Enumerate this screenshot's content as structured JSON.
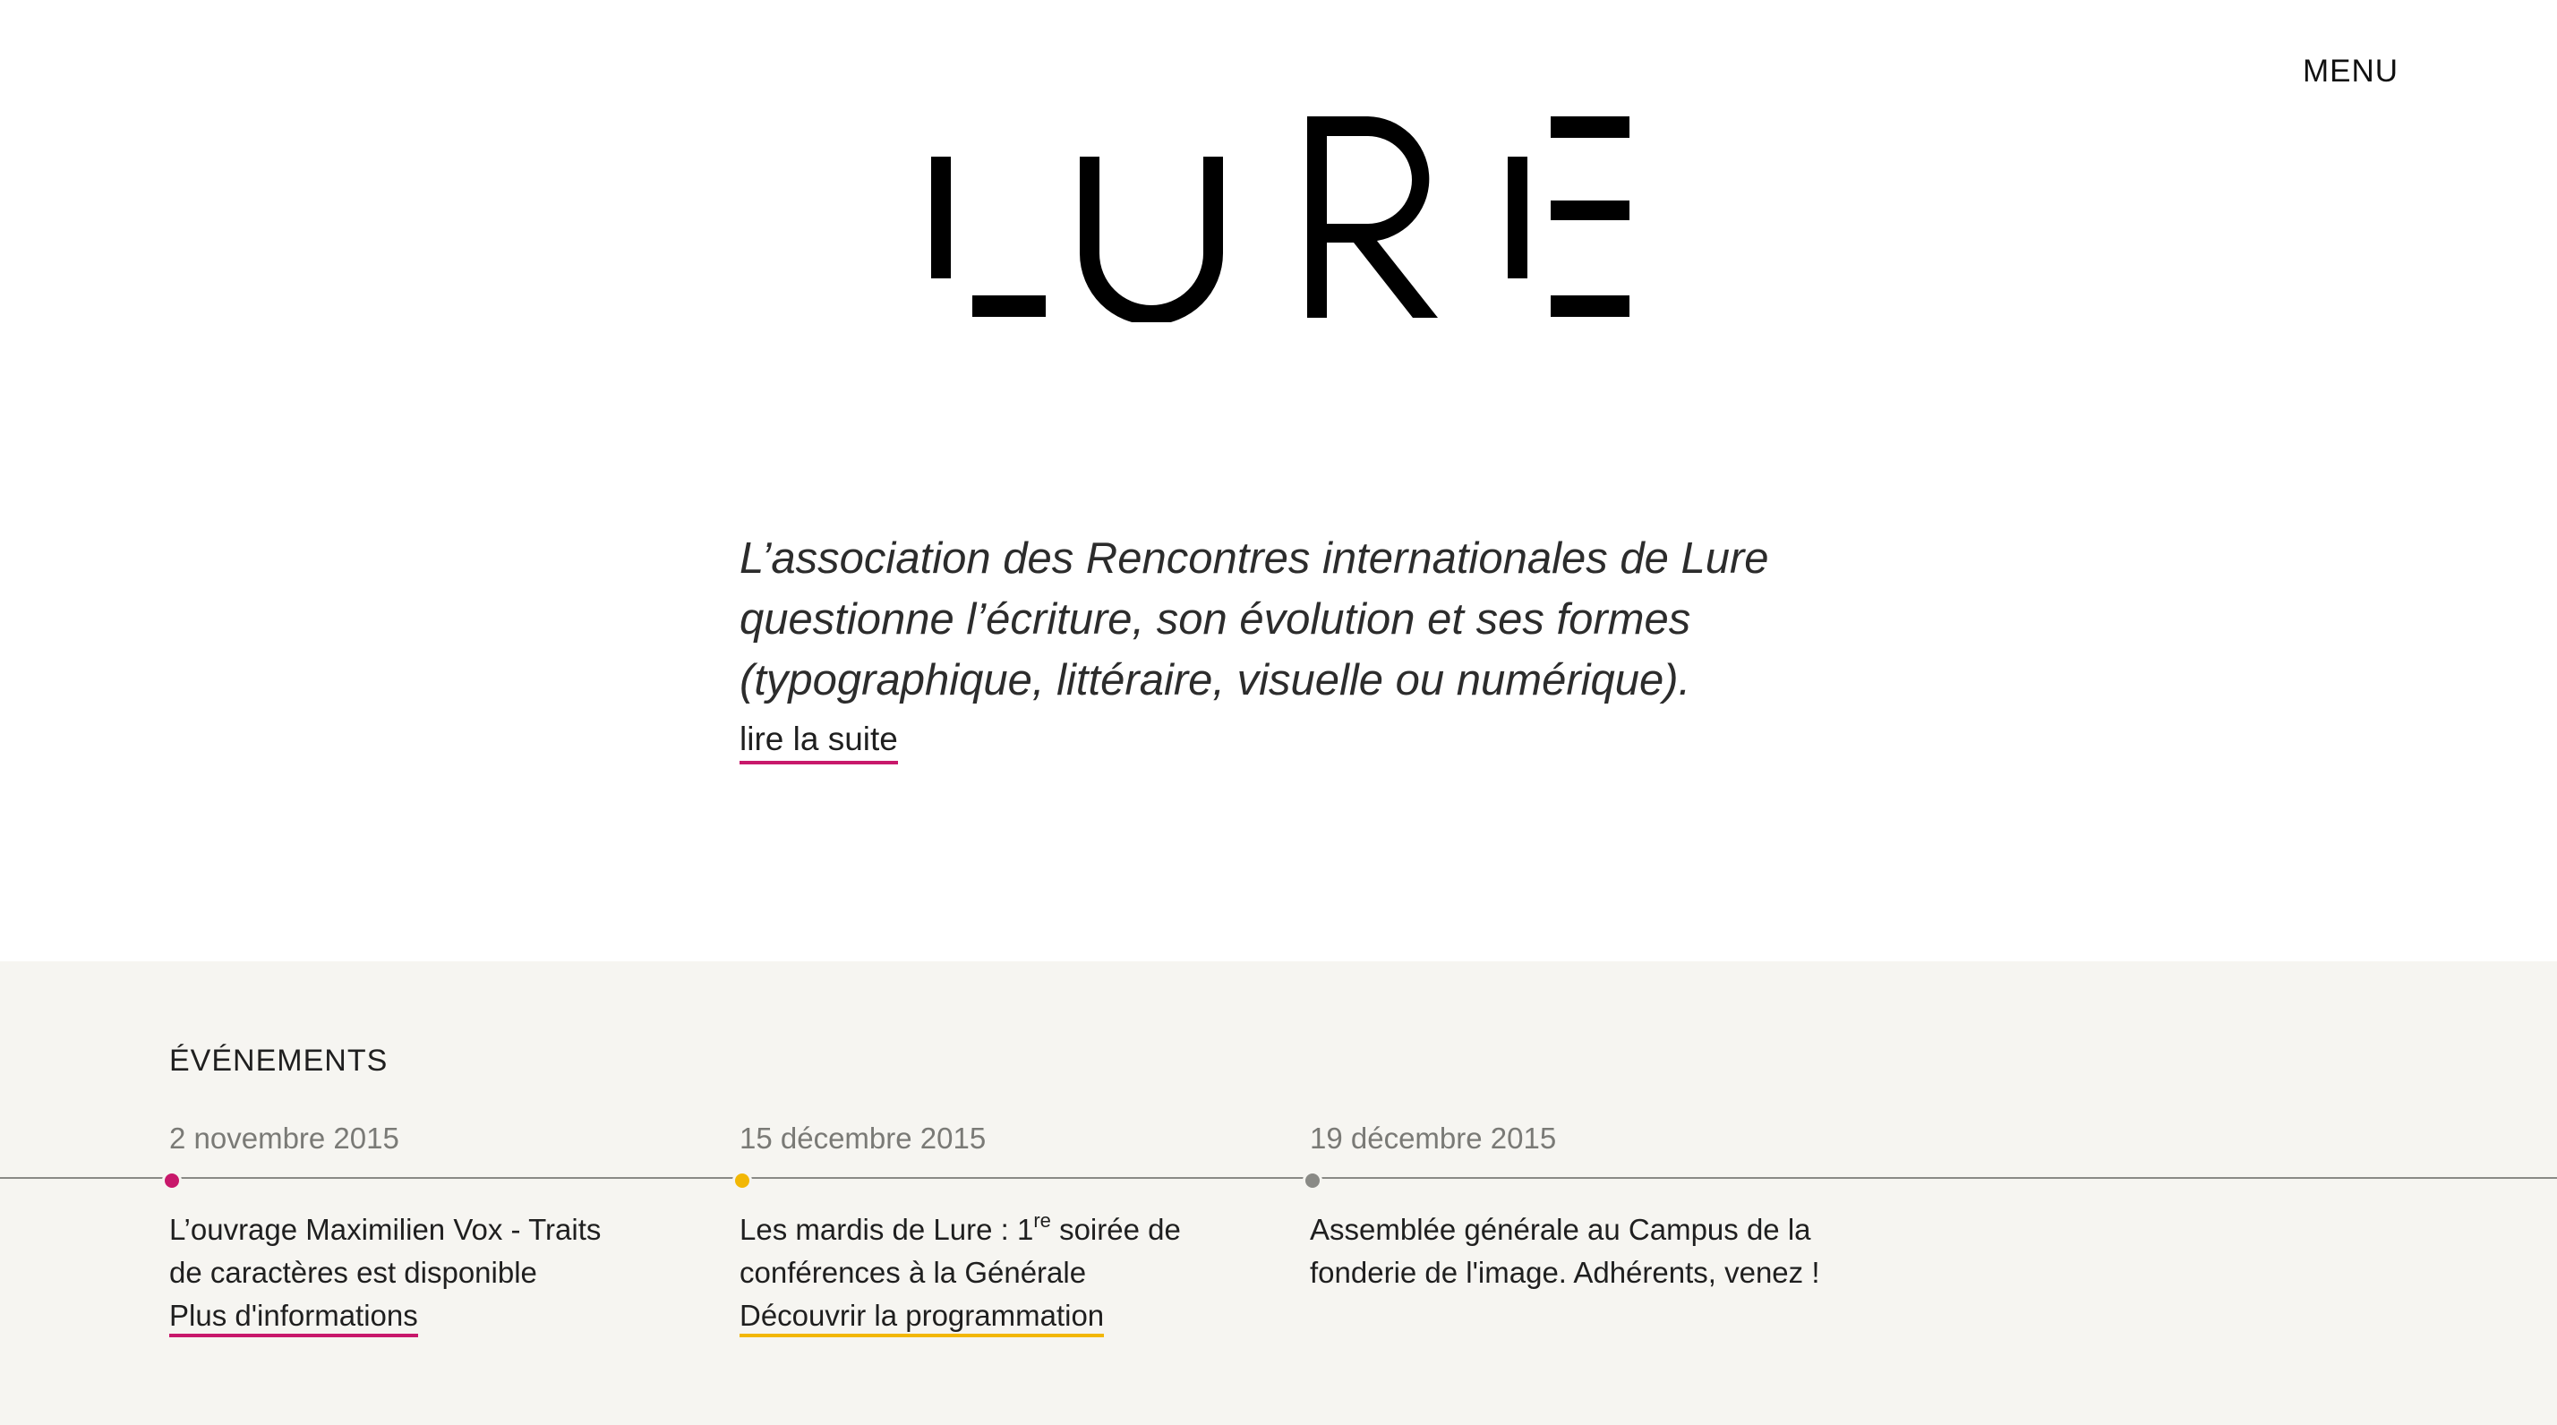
{
  "header": {
    "menu_label": "MENU",
    "logo_text": "LURE"
  },
  "intro": {
    "lines": [
      "L’association des Rencontres internationales de Lure",
      "questionne l’écriture, son évolution et ses formes",
      "(typographique, littéraire, visuelle ou numérique)."
    ],
    "read_more_label": "lire la suite",
    "read_more_color": "#c8186b"
  },
  "events": {
    "heading": "ÉVÉNEMENTS",
    "background": "#f6f5f1",
    "items": [
      {
        "date": "2 novembre 2015",
        "dot_color": "#c8186b",
        "text_before_sup": "L’ouvrage Maximilien Vox - Traits de caractères est disponible",
        "sup": "",
        "text_after_sup": "",
        "link_label": "Plus d'informations",
        "link_color": "#c8186b"
      },
      {
        "date": "15 décembre 2015",
        "dot_color": "#f2b705",
        "text_before_sup": "Les mardis de Lure : 1",
        "sup": "re",
        "text_after_sup": " soirée de conférences à la Générale",
        "link_label": "Découvrir la programmation",
        "link_color": "#f2b705"
      },
      {
        "date": "19 décembre 2015",
        "dot_color": "#8a8a86",
        "text_before_sup": "Assemblée générale au Campus de la fonderie de l'image. Adhérents, venez !",
        "sup": "",
        "text_after_sup": "",
        "link_label": "",
        "link_color": "#8a8a86"
      }
    ]
  }
}
